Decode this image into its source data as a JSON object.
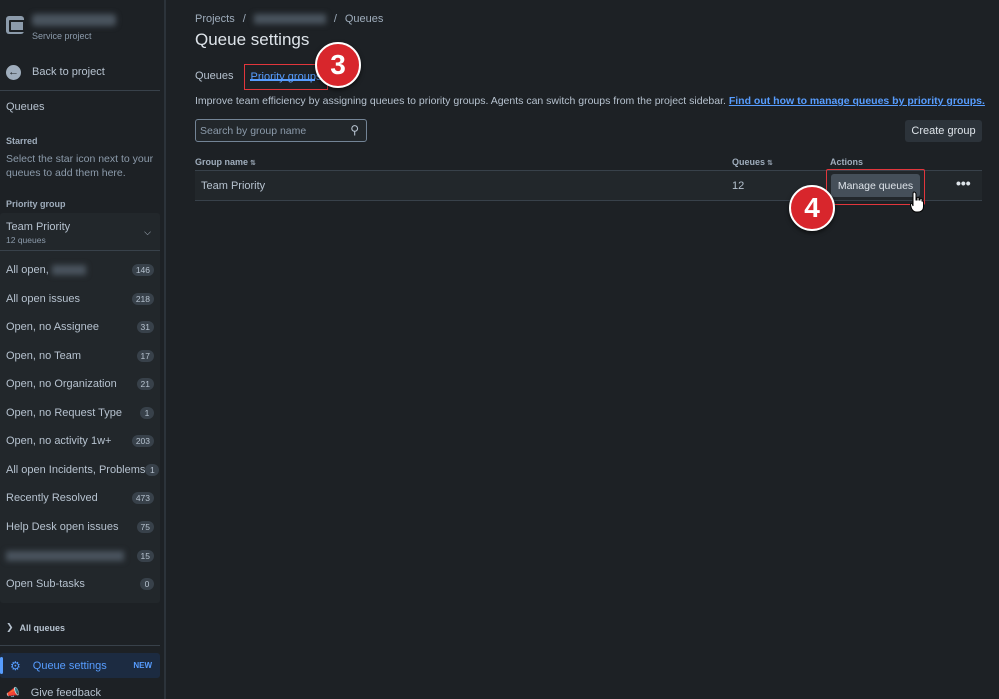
{
  "sidebar": {
    "project_type": "Service project",
    "back_label": "Back to project",
    "queues_title": "Queues",
    "starred_label": "Starred",
    "starred_help": "Select the star icon next to your queues to add them here.",
    "priority_group_label": "Priority group",
    "group": {
      "name": "Team Priority",
      "count": "12 queues"
    },
    "queues": [
      {
        "label": "All open,",
        "count": "146",
        "blurred_suffix": true
      },
      {
        "label": "All open issues",
        "count": "218"
      },
      {
        "label": "Open, no Assignee",
        "count": "31"
      },
      {
        "label": "Open, no Team",
        "count": "17"
      },
      {
        "label": "Open, no Organization",
        "count": "21"
      },
      {
        "label": "Open, no Request Type",
        "count": "1"
      },
      {
        "label": "Open, no activity 1w+",
        "count": "203"
      },
      {
        "label": "All open Incidents, Problems",
        "count": "1"
      },
      {
        "label": "Recently Resolved",
        "count": "473"
      },
      {
        "label": "Help Desk open issues",
        "count": "75"
      },
      {
        "label": "",
        "count": "15",
        "blurred": true
      },
      {
        "label": "Open Sub-tasks",
        "count": "0"
      }
    ],
    "all_queues_label": "All queues",
    "queue_settings": {
      "label": "Queue settings",
      "badge": "NEW"
    },
    "feedback_label": "Give feedback"
  },
  "main": {
    "breadcrumb": {
      "projects": "Projects",
      "queues": "Queues"
    },
    "title": "Queue settings",
    "tabs": [
      {
        "label": "Queues",
        "active": false
      },
      {
        "label": "Priority groups",
        "active": true
      }
    ],
    "intro_text": "Improve team efficiency by assigning queues to priority groups. Agents can switch groups from the project sidebar.",
    "intro_link": "Find out how to manage queues by priority groups.",
    "search": {
      "placeholder": "Search by group name"
    },
    "create_group_label": "Create group",
    "table": {
      "headers": {
        "name": "Group name",
        "queues": "Queues",
        "actions": "Actions"
      },
      "rows": [
        {
          "name": "Team Priority",
          "queues": "12",
          "action": "Manage queues"
        }
      ]
    }
  },
  "markers": {
    "step3": "3",
    "step4": "4"
  },
  "colors": {
    "accent": "#579dff",
    "highlight": "#e2363c",
    "marker": "#d8262c"
  },
  "icons": [
    "project-icon",
    "back-arrow-icon",
    "chevron-down-icon",
    "chevron-right-icon",
    "gear-icon",
    "megaphone-icon",
    "search-icon",
    "more-icon",
    "hand-cursor-icon"
  ]
}
